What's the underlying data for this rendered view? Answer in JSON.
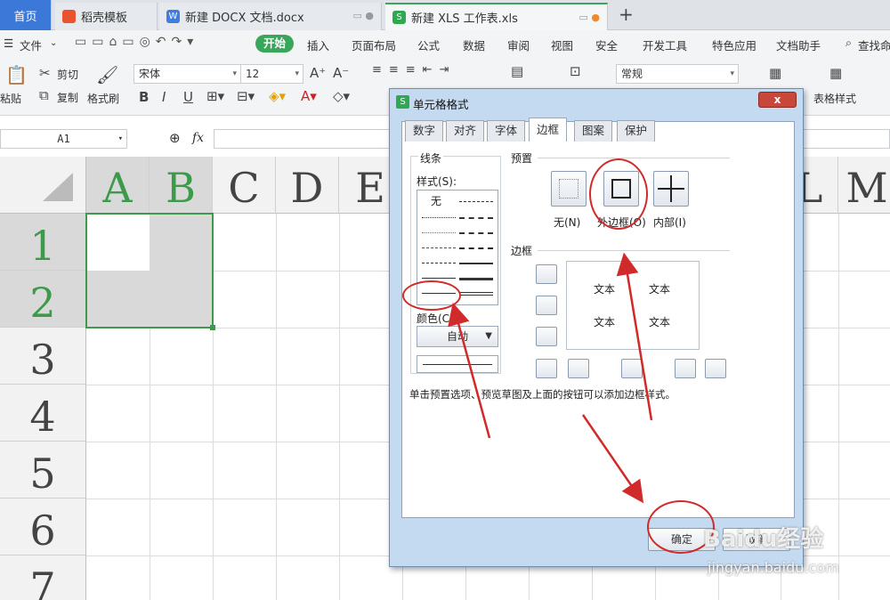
{
  "tabs": [
    {
      "label": "首页"
    },
    {
      "label": "稻壳模板"
    },
    {
      "label": "新建 DOCX 文档.docx"
    },
    {
      "label": "新建 XLS 工作表.xls"
    }
  ],
  "new_tab": "+",
  "menu": {
    "file": "文件",
    "start": "开始",
    "items": [
      "插入",
      "页面布局",
      "公式",
      "数据",
      "审阅",
      "视图",
      "安全",
      "开发工具",
      "特色应用",
      "文档助手"
    ],
    "search": "查找命"
  },
  "toolbar": {
    "cut": "剪切",
    "paste": "粘贴",
    "copy": "复制",
    "format_painter": "格式刷",
    "font": "宋体",
    "size": "12",
    "number_format": "常规",
    "table_style": "表格样式"
  },
  "formula": {
    "namebox": "A1",
    "fx": "fx"
  },
  "sheet": {
    "columns": [
      "A",
      "B",
      "C",
      "D",
      "E",
      "L",
      "M"
    ],
    "rows": [
      "1",
      "2",
      "3",
      "4",
      "5",
      "6",
      "7"
    ]
  },
  "dialog": {
    "title": "单元格格式",
    "close": "x",
    "tabs": [
      "数字",
      "对齐",
      "字体",
      "边框",
      "图案",
      "保护"
    ],
    "line_group": "线条",
    "style_label": "样式(S):",
    "none_style": "无",
    "color_label": "颜色(C):",
    "color_value": "自动",
    "preset_label": "预置",
    "presets": [
      "无(N)",
      "外边框(O)",
      "内部(I)"
    ],
    "border_label": "边框",
    "preview_text": [
      "文本",
      "文本",
      "文本",
      "文本"
    ],
    "hint": "单击预置选项、预览草图及上面的按钮可以添加边框样式。",
    "ok": "确定",
    "cancel": "取消"
  },
  "watermark": {
    "brand": "Baidu经验",
    "url": "jingyan.baidu.com"
  },
  "colors": {
    "accent_green": "#3aa65b",
    "annotation_red": "#d12a2a",
    "selection_border": "#3c9a4a"
  }
}
